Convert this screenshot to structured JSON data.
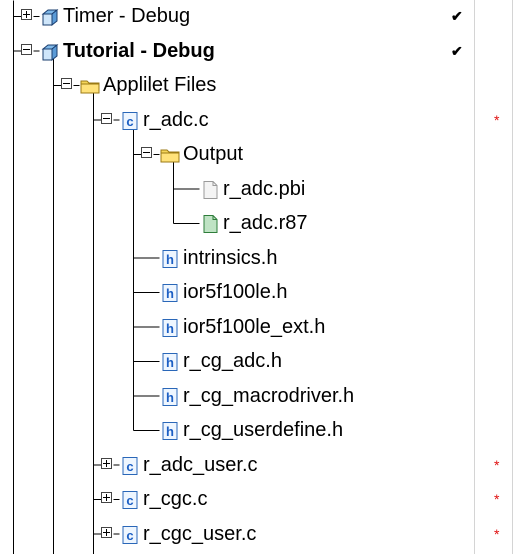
{
  "rows": [
    {
      "label": "Timer - Debug",
      "icon": "project-cube-icon",
      "expander": "plus",
      "level": 0,
      "check": "✔",
      "mark": ""
    },
    {
      "label": "Tutorial - Debug",
      "icon": "project-cube-icon",
      "expander": "minus",
      "level": 0,
      "check": "✔",
      "mark": "",
      "bold": true
    },
    {
      "label": "Applilet Files",
      "icon": "folder-icon",
      "expander": "minus",
      "level": 1,
      "check": "",
      "mark": ""
    },
    {
      "label": "r_adc.c",
      "icon": "c-file-icon",
      "expander": "minus",
      "level": 2,
      "check": "",
      "mark": "*"
    },
    {
      "label": "Output",
      "icon": "folder-icon",
      "expander": "minus",
      "level": 3,
      "check": "",
      "mark": ""
    },
    {
      "label": "r_adc.pbi",
      "icon": "file-icon",
      "expander": "",
      "level": 4,
      "check": "",
      "mark": ""
    },
    {
      "label": "r_adc.r87",
      "icon": "green-file-icon",
      "expander": "",
      "level": 4,
      "check": "",
      "mark": ""
    },
    {
      "label": "intrinsics.h",
      "icon": "h-file-icon",
      "expander": "",
      "level": 3,
      "check": "",
      "mark": ""
    },
    {
      "label": "ior5f100le.h",
      "icon": "h-file-icon",
      "expander": "",
      "level": 3,
      "check": "",
      "mark": ""
    },
    {
      "label": "ior5f100le_ext.h",
      "icon": "h-file-icon",
      "expander": "",
      "level": 3,
      "check": "",
      "mark": ""
    },
    {
      "label": "r_cg_adc.h",
      "icon": "h-file-icon",
      "expander": "",
      "level": 3,
      "check": "",
      "mark": ""
    },
    {
      "label": "r_cg_macrodriver.h",
      "icon": "h-file-icon",
      "expander": "",
      "level": 3,
      "check": "",
      "mark": ""
    },
    {
      "label": "r_cg_userdefine.h",
      "icon": "h-file-icon",
      "expander": "",
      "level": 3,
      "check": "",
      "mark": ""
    },
    {
      "label": "r_adc_user.c",
      "icon": "c-file-icon",
      "expander": "plus",
      "level": 2,
      "check": "",
      "mark": "*"
    },
    {
      "label": "r_cgc.c",
      "icon": "c-file-icon",
      "expander": "plus",
      "level": 2,
      "check": "",
      "mark": "*"
    },
    {
      "label": "r_cgc_user.c",
      "icon": "c-file-icon",
      "expander": "plus",
      "level": 2,
      "check": "",
      "mark": "*"
    }
  ]
}
